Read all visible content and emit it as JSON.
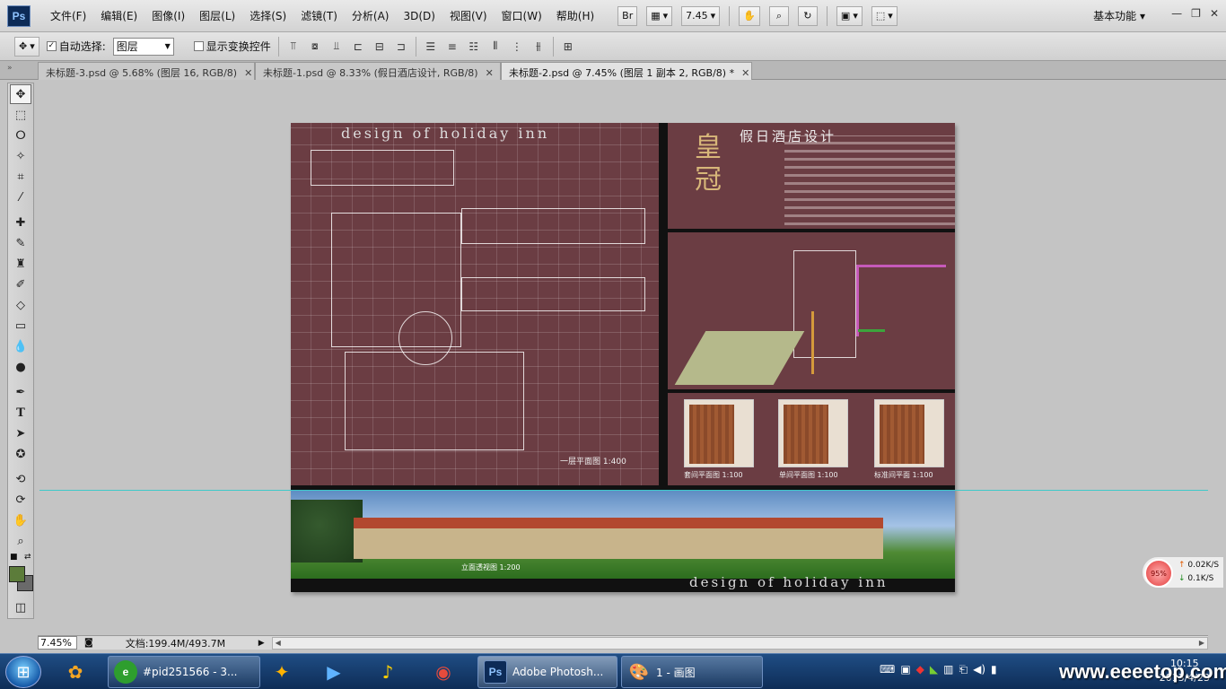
{
  "app": {
    "logo": "Ps"
  },
  "menu": [
    "文件(F)",
    "编辑(E)",
    "图像(I)",
    "图层(L)",
    "选择(S)",
    "滤镜(T)",
    "分析(A)",
    "3D(D)",
    "视图(V)",
    "窗口(W)",
    "帮助(H)"
  ],
  "menubar_tools": {
    "bridge": "Br",
    "zoom_level": "7.45",
    "workspace": "基本功能"
  },
  "options": {
    "auto_select_label": "自动选择:",
    "auto_select_checked": true,
    "layer_select_value": "图层",
    "show_transform_label": "显示变换控件",
    "show_transform_checked": false
  },
  "tabs": [
    {
      "label": "未标题-3.psd @ 5.68% (图层 16, RGB/8)",
      "active": false
    },
    {
      "label": "未标题-1.psd @ 8.33% (假日酒店设计, RGB/8)",
      "active": false
    },
    {
      "label": "未标题-2.psd @ 7.45% (图层 1 副本 2, RGB/8) *",
      "active": true
    }
  ],
  "canvas": {
    "title_top": "design of holiday inn",
    "title_cn": "假日酒店设计",
    "emblem": "皇冠",
    "main_scale": "一层平面图 1:400",
    "room_captions": [
      "套间平面图 1:100",
      "单间平面图 1:100",
      "标准间平面 1:100"
    ],
    "render_caption": "立面透视图 1:200",
    "title_bottom": "design of holiday inn"
  },
  "colors": {
    "board": "#6b3d43",
    "foreground": "#5c7c3a",
    "background": "#6a6a6a",
    "guide": "#3fc9c9"
  },
  "status": {
    "zoom": "7.45%",
    "doc": "文档:199.4M/493.7M"
  },
  "network": {
    "percent": "95%",
    "up": "0.02K/S",
    "down": "0.1K/S"
  },
  "taskbar": {
    "items": [
      {
        "label": "#pid251566 - 3...",
        "active": false
      },
      {
        "label": "Adobe Photosh...",
        "active": true
      },
      {
        "label": "1 - 画图",
        "active": false
      }
    ],
    "time": "10:15",
    "date": "2013/4/23"
  },
  "watermark": "www.eeeetop.com"
}
